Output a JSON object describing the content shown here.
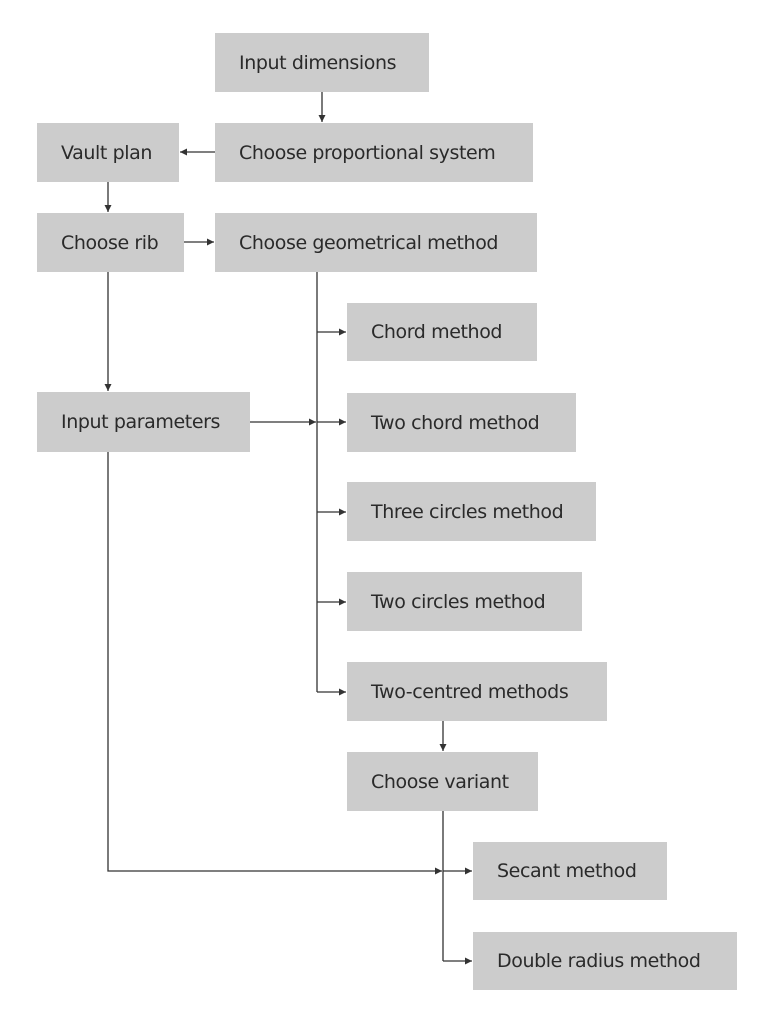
{
  "diagram": {
    "type": "flowchart",
    "colors": {
      "node_fill": "#cccccc",
      "edge": "#333333",
      "text": "#2a2a2a",
      "background": "#ffffff"
    },
    "nodes": [
      {
        "id": "input-dimensions",
        "label": "Input dimensions"
      },
      {
        "id": "choose-proportional-system",
        "label": "Choose proportional system"
      },
      {
        "id": "vault-plan",
        "label": "Vault plan"
      },
      {
        "id": "choose-rib",
        "label": "Choose rib"
      },
      {
        "id": "choose-geometrical-method",
        "label": "Choose geometrical method"
      },
      {
        "id": "chord-method",
        "label": "Chord method"
      },
      {
        "id": "input-parameters",
        "label": "Input parameters"
      },
      {
        "id": "two-chord-method",
        "label": "Two chord method"
      },
      {
        "id": "three-circles-method",
        "label": "Three circles method"
      },
      {
        "id": "two-circles-method",
        "label": "Two circles method"
      },
      {
        "id": "two-centred-methods",
        "label": "Two-centred methods"
      },
      {
        "id": "choose-variant",
        "label": "Choose variant"
      },
      {
        "id": "secant-method",
        "label": "Secant method"
      },
      {
        "id": "double-radius-method",
        "label": "Double radius method"
      }
    ],
    "edges": [
      {
        "from": "input-dimensions",
        "to": "choose-proportional-system"
      },
      {
        "from": "choose-proportional-system",
        "to": "vault-plan"
      },
      {
        "from": "vault-plan",
        "to": "choose-rib"
      },
      {
        "from": "choose-rib",
        "to": "choose-geometrical-method"
      },
      {
        "from": "choose-rib",
        "to": "input-parameters"
      },
      {
        "from": "choose-geometrical-method",
        "to": "chord-method"
      },
      {
        "from": "choose-geometrical-method",
        "to": "two-chord-method"
      },
      {
        "from": "choose-geometrical-method",
        "to": "three-circles-method"
      },
      {
        "from": "choose-geometrical-method",
        "to": "two-circles-method"
      },
      {
        "from": "choose-geometrical-method",
        "to": "two-centred-methods"
      },
      {
        "from": "input-parameters",
        "to": "choose-geometrical-method-branch"
      },
      {
        "from": "two-centred-methods",
        "to": "choose-variant"
      },
      {
        "from": "choose-variant",
        "to": "secant-method"
      },
      {
        "from": "choose-variant",
        "to": "double-radius-method"
      },
      {
        "from": "input-parameters",
        "to": "choose-variant-branch"
      }
    ]
  }
}
